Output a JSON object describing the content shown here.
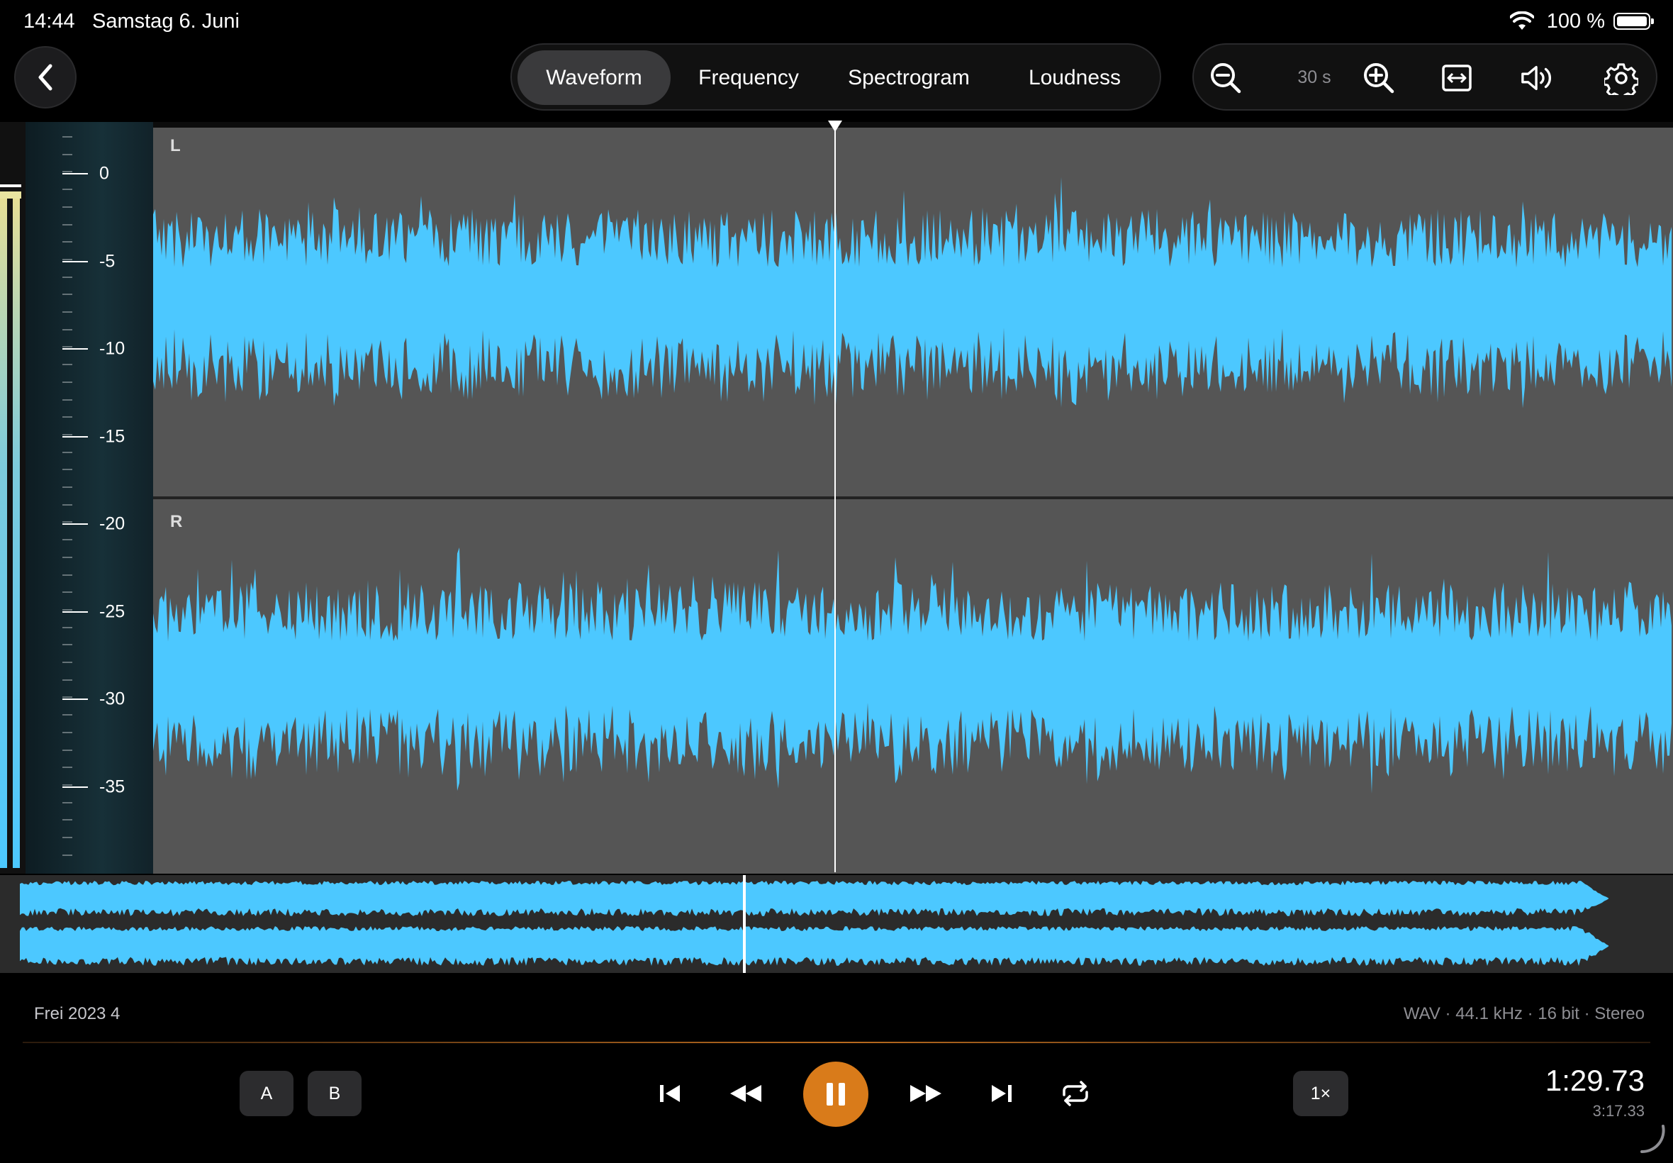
{
  "status_bar": {
    "time": "14:44",
    "date": "Samstag 6. Juni",
    "battery": "100 %"
  },
  "tabs": [
    {
      "label": "Waveform",
      "active": true
    },
    {
      "label": "Frequency",
      "active": false
    },
    {
      "label": "Spectrogram",
      "active": false
    },
    {
      "label": "Loudness",
      "active": false
    }
  ],
  "toolbar": {
    "zoom_out_icon": "zoom-out-icon",
    "zoom_level": "30 s",
    "zoom_in_icon": "zoom-in-icon",
    "fit_icon": "fit-width-icon",
    "volume_icon": "volume-icon",
    "settings_icon": "gear-icon"
  },
  "waveform": {
    "db_scale": [
      "0",
      "-5",
      "-10",
      "-15",
      "-20",
      "-25",
      "-30",
      "-35"
    ],
    "channels": [
      "L",
      "R"
    ],
    "color": "#4cc8ff",
    "background": "#555555"
  },
  "track": {
    "name": "Frei 2023 4",
    "format": "WAV · 44.1 kHz · 16 bit · Stereo",
    "position": "1:29.73",
    "duration": "3:17.33",
    "progress": 0.455
  },
  "transport": {
    "a_label": "A",
    "b_label": "B",
    "speed": "1×",
    "accent": "#d97b1a"
  }
}
